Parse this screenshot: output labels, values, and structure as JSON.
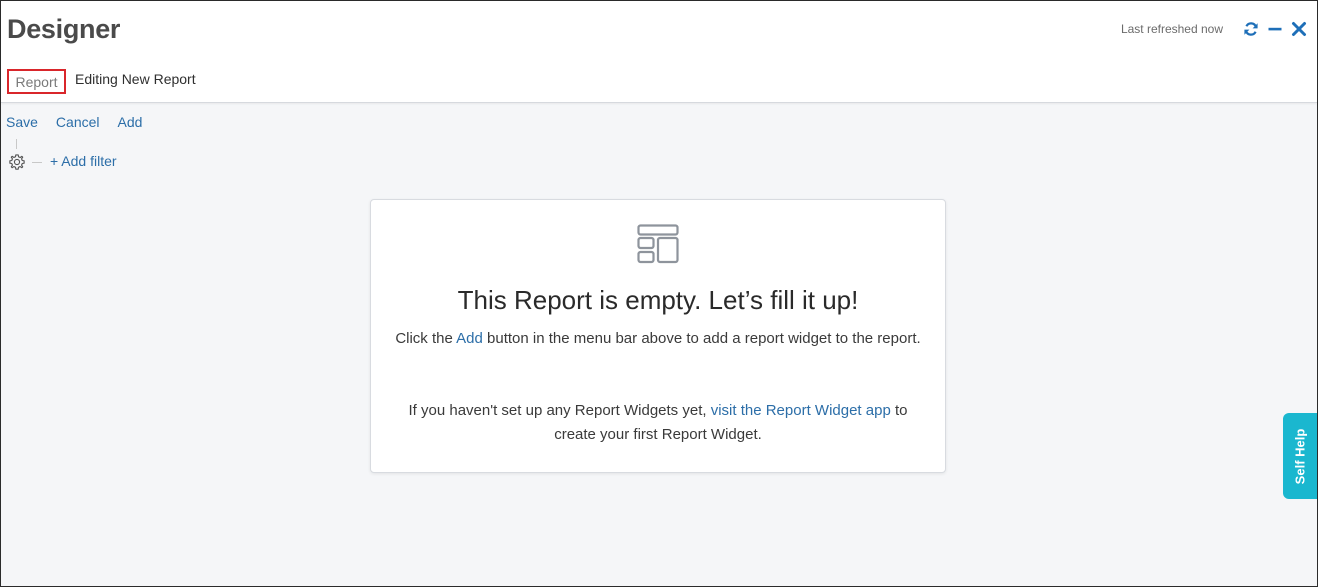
{
  "header": {
    "title": "Designer",
    "tab_label": "Report",
    "editing_label": "Editing New Report",
    "last_refreshed": "Last refreshed now",
    "icons": [
      "refresh-icon",
      "minimize-icon",
      "close-icon"
    ]
  },
  "toolbar": {
    "save_label": "Save",
    "cancel_label": "Cancel",
    "add_label": "Add"
  },
  "filter": {
    "icon": "gear-icon",
    "add_filter_label": "+ Add filter"
  },
  "empty_state": {
    "icon": "layout-icon",
    "title": "This Report is empty. Let’s fill it up!",
    "p1_before": "Click the ",
    "p1_link": "Add",
    "p1_after": " button in the menu bar above to add a report widget to the report.",
    "p2_before": "If you haven't set up any Report Widgets yet, ",
    "p2_link": "visit the Report Widget app",
    "p2_after": " to create your first Report Widget."
  },
  "self_help": {
    "label": "Self Help"
  },
  "colors": {
    "accent": "#2c6ea8",
    "highlight_border": "#d9262b",
    "self_help_bg": "#1ab7cf"
  }
}
